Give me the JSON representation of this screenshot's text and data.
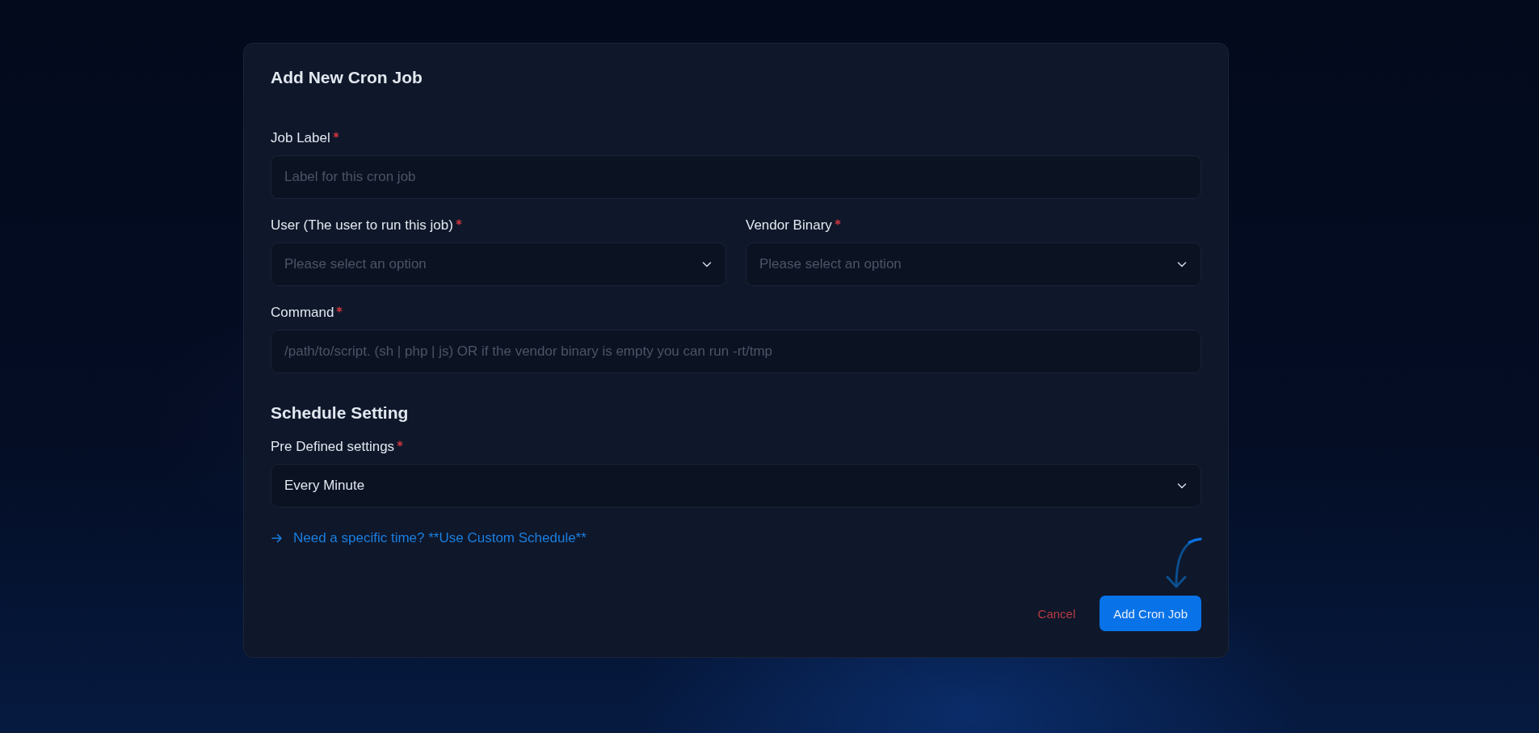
{
  "dialog": {
    "title": "Add New Cron Job",
    "rows": [
      [
        {
          "kind": "text",
          "label": "Job Label",
          "required": true,
          "placeholder": "Label for this cron job"
        }
      ],
      [
        {
          "kind": "select",
          "label": "User (The user to run this job)",
          "required": true,
          "placeholder": "Please select an option"
        },
        {
          "kind": "select",
          "label": "Vendor Binary",
          "required": true,
          "placeholder": "Please select an option"
        }
      ],
      [
        {
          "kind": "text",
          "label": "Command",
          "required": true,
          "placeholder": "/path/to/script. (sh | php | js) OR if the vendor binary is empty you can run -rt/tmp"
        }
      ]
    ],
    "schedule": {
      "heading": "Schedule Setting",
      "rows": [
        [
          {
            "kind": "select",
            "label": "Pre Defined settings",
            "required": true,
            "value": "Every Minute"
          }
        ]
      ],
      "link": "Need a specific time? **Use Custom Schedule**"
    },
    "buttons": [
      {
        "kind": "text",
        "label": "Cancel"
      },
      {
        "kind": "primary",
        "label": "Add Cron Job"
      }
    ]
  }
}
